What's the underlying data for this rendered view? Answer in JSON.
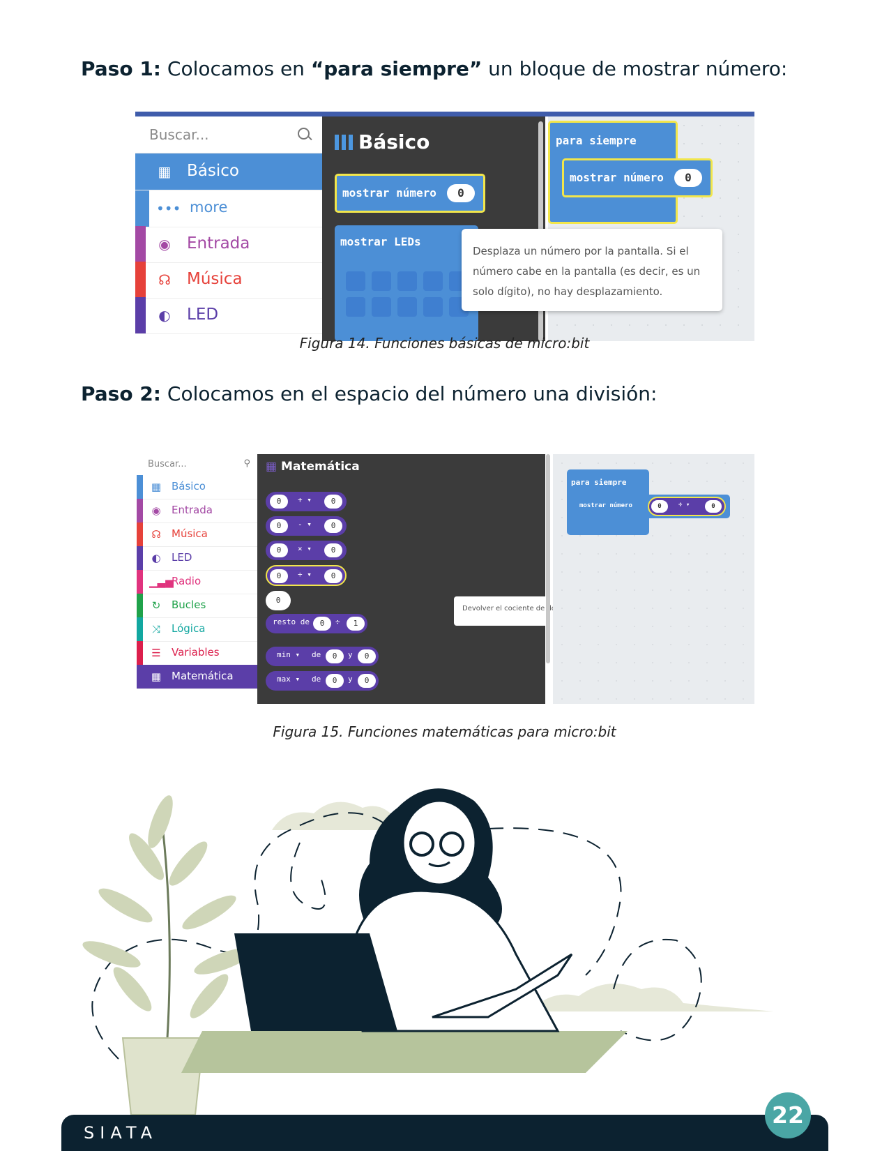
{
  "step1": {
    "label": "Paso 1:",
    "text_a": " Colocamos en ",
    "quoted": "“para siempre”",
    "text_b": " un bloque de mostrar número:"
  },
  "fig14": {
    "search_placeholder": "Buscar...",
    "categories": [
      {
        "label": "Básico",
        "color": "#4c8fd6"
      },
      {
        "label": "more",
        "color": "#4c8fd6"
      },
      {
        "label": "Entrada",
        "color": "#a349a4"
      },
      {
        "label": "Música",
        "color": "#e6413a"
      },
      {
        "label": "LED",
        "color": "#5b3ea8"
      }
    ],
    "flyout_title": "Básico",
    "block_show_number": "mostrar número",
    "block_show_number_value": "0",
    "block_show_leds": "mostrar LEDs",
    "ws_forever": "para siempre",
    "ws_show_number": "mostrar número",
    "ws_value": "0",
    "tooltip": "Desplaza un número por la pantalla. Si el número cabe en la pantalla (es decir, es un solo dígito), no hay desplazamiento."
  },
  "caption14": "Figura 14. Funciones básicas de micro:bit",
  "step2": {
    "label": "Paso 2:",
    "text": " Colocamos en el espacio del número una división:"
  },
  "fig15": {
    "search_placeholder": "Buscar...",
    "categories": [
      {
        "label": "Básico",
        "color": "#4c8fd6",
        "icon": "grid-icon"
      },
      {
        "label": "Entrada",
        "color": "#a349a4",
        "icon": "target-icon"
      },
      {
        "label": "Música",
        "color": "#e6413a",
        "icon": "headphones-icon"
      },
      {
        "label": "LED",
        "color": "#5b3ea8",
        "icon": "toggle-icon"
      },
      {
        "label": "Radio",
        "color": "#e0337e",
        "icon": "signal-icon"
      },
      {
        "label": "Bucles",
        "color": "#1fa24a",
        "icon": "loop-icon"
      },
      {
        "label": "Lógica",
        "color": "#12a7a0",
        "icon": "shuffle-icon"
      },
      {
        "label": "Variables",
        "color": "#dc1f4c",
        "icon": "list-icon"
      },
      {
        "label": "Matemática",
        "color": "#5b3ea8",
        "icon": "calculator-icon"
      }
    ],
    "flyout_title": "Matemática",
    "ops": [
      "+",
      "-",
      "×",
      "÷"
    ],
    "zero": "0",
    "one": "1",
    "remainder_label": "resto de",
    "min_label": "min",
    "max_label": "max",
    "de": "de",
    "y": "y",
    "tooltip": "Devolver el cociente de dos números.",
    "ws_forever": "para siempre",
    "ws_show_number": "mostrar número"
  },
  "caption15": "Figura 15. Funciones matemáticas para micro:bit",
  "footer": {
    "brand": "SIATA",
    "page": "22"
  }
}
